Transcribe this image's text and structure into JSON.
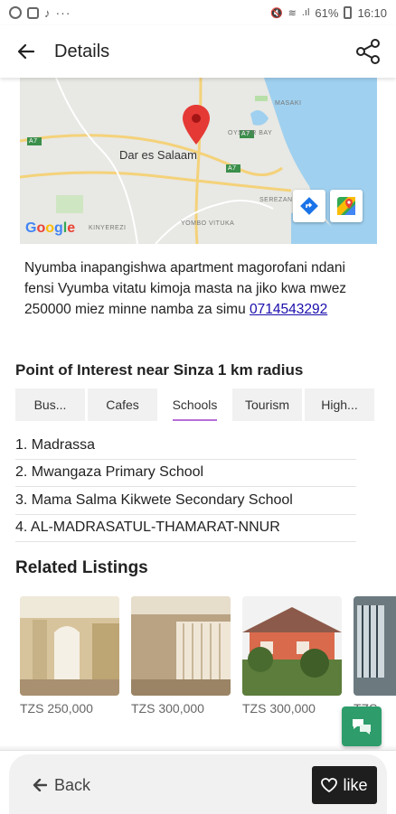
{
  "status_bar": {
    "battery": "61%",
    "time": "16:10"
  },
  "app_bar": {
    "title": "Details",
    "back_icon": "arrow-left-icon",
    "share_icon": "share-icon"
  },
  "map": {
    "city_label": "Dar es Salaam",
    "labels": [
      "MASAKI",
      "OYSTER BAY",
      "SEREZANI",
      "YOMBO VITUKA",
      "KINYEREZI",
      "A7",
      "A7",
      "A7"
    ],
    "google_logo": "Google",
    "directions_icon": "directions-icon",
    "maps_app_icon": "google-maps-icon"
  },
  "description": {
    "text": "Nyumba inapangishwa apartment magorofani ndani fensi Vyumba vitatu kimoja masta na jiko kwa mwez 250000 miez minne namba za simu ",
    "phone": "0714543292"
  },
  "poi": {
    "title": "Point of Interest near Sinza 1 km radius",
    "tabs": [
      {
        "label": "Bus..."
      },
      {
        "label": "Cafes"
      },
      {
        "label": "Schools"
      },
      {
        "label": "Tourism"
      },
      {
        "label": "High..."
      }
    ],
    "active_tab": "Schools",
    "items": [
      "1. Madrassa",
      "2. Mwangaza Primary School",
      "3. Mama Salma Kikwete Secondary School",
      "4. AL-MADRASATUL-THAMARAT-NNUR"
    ]
  },
  "related": {
    "title": "Related Listings",
    "listings": [
      {
        "price": "TZS 250,000"
      },
      {
        "price": "TZS 300,000"
      },
      {
        "price": "TZS 300,000"
      },
      {
        "price": "TZS"
      }
    ]
  },
  "bottom": {
    "back_label": "Back",
    "like_label": "like",
    "back_icon": "arrow-left-icon",
    "like_icon": "heart-icon"
  },
  "colors": {
    "accent_underline": "#b86fd8",
    "chat_fab": "#2e9d6b",
    "like_button": "#1e1e1e",
    "link": "#1a0dab",
    "map_pin": "#e53935"
  }
}
